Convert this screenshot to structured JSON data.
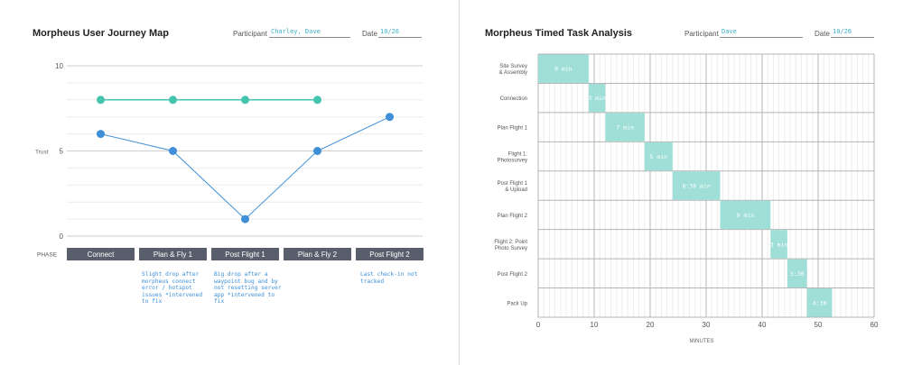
{
  "journey": {
    "title": "Morpheus User Journey Map",
    "participant_label": "Participant",
    "participant_value": "Charley, Dave",
    "date_label": "Date",
    "date_value": "10/26",
    "y_axis_label": "Trust",
    "phase_label": "PHASE",
    "notes": [
      "Slight drop after morpheus connect error / hotspot issues *intervened to fix",
      "Big drop after  a waypoint bug and by not resetting server app *intervened to fix",
      "Last check-in not tracked"
    ]
  },
  "timed": {
    "title": "Morpheus Timed Task Analysis",
    "participant_label": "Participant",
    "participant_value": "Dave",
    "date_label": "Date",
    "date_value": "10/26",
    "x_axis_label": "MINUTES"
  },
  "colors": {
    "teal": "#45c4ad",
    "blue": "#3e8fd8",
    "phase_box": "#585e6b",
    "gantt_bar": "#9fdfd8"
  },
  "chart_data": [
    {
      "type": "line",
      "title": "Morpheus User Journey Map",
      "ylabel": "Trust",
      "xlabel": "PHASE",
      "ylim": [
        0,
        10
      ],
      "yticks": [
        0,
        5,
        10
      ],
      "categories": [
        "Connect",
        "Plan & Fly 1",
        "Post Flight 1",
        "Plan & Fly 2",
        "Post Flight 2"
      ],
      "series": [
        {
          "color": "#45c4ad",
          "values": [
            8,
            8,
            8,
            8,
            null
          ]
        },
        {
          "color": "#3e8fd8",
          "values": [
            6,
            5,
            1,
            5,
            7
          ]
        }
      ],
      "grid": true
    },
    {
      "type": "bar",
      "orientation": "gantt",
      "title": "Morpheus Timed Task Analysis",
      "xlabel": "MINUTES",
      "xlim": [
        0,
        60
      ],
      "xticks": [
        0,
        10,
        20,
        30,
        40,
        50,
        60
      ],
      "tasks": [
        {
          "label": "Site Survey & Assembly",
          "start": 0,
          "end": 9,
          "text": "9 min"
        },
        {
          "label": "Connection",
          "start": 9,
          "end": 12,
          "text": "3 min"
        },
        {
          "label": "Plan Flight 1",
          "start": 12,
          "end": 19,
          "text": "7 min"
        },
        {
          "label": "Flight 1: Photosurvey",
          "start": 19,
          "end": 24,
          "text": "5 min"
        },
        {
          "label": "Post Flight 1 & Upload",
          "start": 24,
          "end": 32.5,
          "text": "8:30 min"
        },
        {
          "label": "Plan Flight 2",
          "start": 32.5,
          "end": 41.5,
          "text": "9 min"
        },
        {
          "label": "Flight 2: Point Photo Survey",
          "start": 41.5,
          "end": 44.5,
          "text": "3 min"
        },
        {
          "label": "Post Flight 2",
          "start": 44.5,
          "end": 48,
          "text": "3:30"
        },
        {
          "label": "Pack Up",
          "start": 48,
          "end": 52.5,
          "text": "4:30"
        }
      ],
      "grid": true
    }
  ]
}
